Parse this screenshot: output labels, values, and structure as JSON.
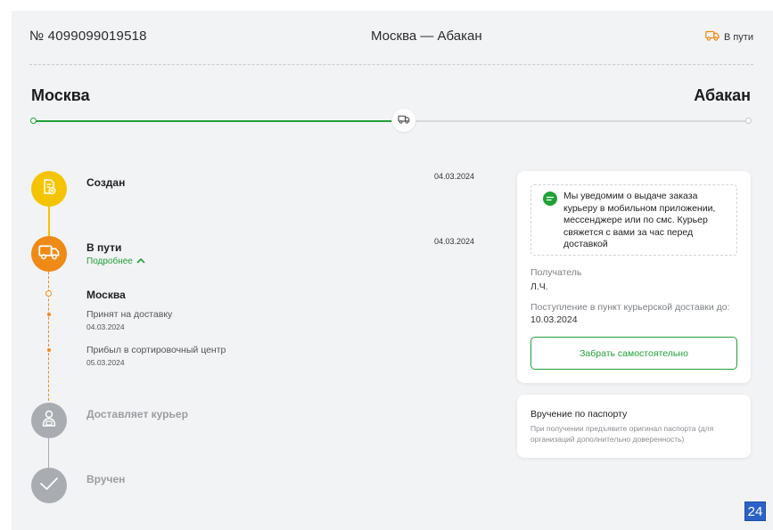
{
  "header": {
    "track_number": "№ 4099099019518",
    "route": "Москва — Абакан",
    "status": "В пути",
    "status_icon": "truck-icon",
    "status_color": "#f08a16"
  },
  "route_bar": {
    "from": "Москва",
    "to": "Абакан",
    "progress": 0.5,
    "progress_color": "#21a038",
    "marker_icon": "truck-icon"
  },
  "timeline": {
    "created": {
      "title": "Создан",
      "date": "04.03.2024",
      "icon": "document-plus-icon",
      "color": "#f5c400"
    },
    "in_transit": {
      "title": "В пути",
      "date": "04.03.2024",
      "details_link": "Подробнее",
      "icon": "truck-icon",
      "color": "#f08a16",
      "city": "Москва",
      "events": [
        {
          "label": "Принят на доставку",
          "date": "04.03.2024"
        },
        {
          "label": "Прибыл в сортировочный центр",
          "date": "05.03.2024"
        }
      ]
    },
    "courier": {
      "title": "Доставляет курьер",
      "icon": "courier-icon",
      "color": "#a9acb0"
    },
    "delivered": {
      "title": "Вручен",
      "icon": "check-icon",
      "color": "#a9acb0"
    }
  },
  "info_card": {
    "notice": "Мы уведомим о выдаче заказа курьеру в мобильном приложении, мессенджере или по смс. Курьер свяжется с вами за час перед доставкой",
    "notice_icon": "chat-icon",
    "recipient_label": "Получатель",
    "recipient_value": "Л.Ч.",
    "arrival_label": "Поступление в пункт курьерской доставки до:",
    "arrival_value": "10.03.2024",
    "pickup_button": "Забрать самостоятельно"
  },
  "passport_card": {
    "title": "Вручение по паспорту",
    "text": "При получении предъявите оригинал паспорта (для организаций дополнительно доверенность)"
  },
  "badge": "24"
}
